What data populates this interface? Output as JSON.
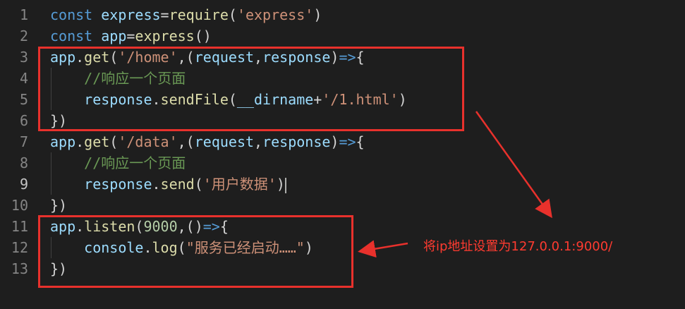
{
  "editor": {
    "active_line": 9,
    "lines": [
      {
        "n": "1",
        "tokens": [
          [
            "kw",
            "const "
          ],
          [
            "id",
            "express"
          ],
          [
            "pl",
            "="
          ],
          [
            "fn",
            "require"
          ],
          [
            "pl",
            "("
          ],
          [
            "str",
            "'express'"
          ],
          [
            "pl",
            ")"
          ]
        ]
      },
      {
        "n": "2",
        "tokens": [
          [
            "kw",
            "const "
          ],
          [
            "id",
            "app"
          ],
          [
            "pl",
            "="
          ],
          [
            "fn",
            "express"
          ],
          [
            "pl",
            "()"
          ]
        ]
      },
      {
        "n": "3",
        "tokens": [
          [
            "id",
            "app"
          ],
          [
            "pl",
            "."
          ],
          [
            "fn",
            "get"
          ],
          [
            "pl",
            "("
          ],
          [
            "str",
            "'/home'"
          ],
          [
            "pl",
            ",("
          ],
          [
            "par",
            "request"
          ],
          [
            "pl",
            ","
          ],
          [
            "par",
            "response"
          ],
          [
            "pl",
            ")"
          ],
          [
            "arrow",
            "=>"
          ],
          [
            "pl",
            "{"
          ]
        ]
      },
      {
        "n": "4",
        "tokens": [
          [
            "pl",
            "    "
          ],
          [
            "cm",
            "//响应一个页面"
          ]
        ]
      },
      {
        "n": "5",
        "tokens": [
          [
            "pl",
            "    "
          ],
          [
            "id",
            "response"
          ],
          [
            "pl",
            "."
          ],
          [
            "fn",
            "sendFile"
          ],
          [
            "pl",
            "("
          ],
          [
            "id",
            "__dirname"
          ],
          [
            "pl",
            "+"
          ],
          [
            "str",
            "'/1.html'"
          ],
          [
            "pl",
            ")"
          ]
        ]
      },
      {
        "n": "6",
        "tokens": [
          [
            "pl",
            "})"
          ]
        ]
      },
      {
        "n": "7",
        "tokens": [
          [
            "id",
            "app"
          ],
          [
            "pl",
            "."
          ],
          [
            "fn",
            "get"
          ],
          [
            "pl",
            "("
          ],
          [
            "str",
            "'/data'"
          ],
          [
            "pl",
            ",("
          ],
          [
            "par",
            "request"
          ],
          [
            "pl",
            ","
          ],
          [
            "par",
            "response"
          ],
          [
            "pl",
            ")"
          ],
          [
            "arrow",
            "=>"
          ],
          [
            "pl",
            "{"
          ]
        ]
      },
      {
        "n": "8",
        "tokens": [
          [
            "pl",
            "    "
          ],
          [
            "cm",
            "//响应一个页面"
          ]
        ]
      },
      {
        "n": "9",
        "tokens": [
          [
            "pl",
            "    "
          ],
          [
            "id",
            "response"
          ],
          [
            "pl",
            "."
          ],
          [
            "fn",
            "send"
          ],
          [
            "pl",
            "("
          ],
          [
            "str",
            "'用户数据'"
          ],
          [
            "pl",
            ")"
          ]
        ]
      },
      {
        "n": "10",
        "tokens": [
          [
            "pl",
            "})"
          ]
        ]
      },
      {
        "n": "11",
        "tokens": [
          [
            "id",
            "app"
          ],
          [
            "pl",
            "."
          ],
          [
            "fn",
            "listen"
          ],
          [
            "pl",
            "("
          ],
          [
            "num",
            "9000"
          ],
          [
            "pl",
            ",()"
          ],
          [
            "arrow",
            "=>"
          ],
          [
            "pl",
            "{"
          ]
        ]
      },
      {
        "n": "12",
        "tokens": [
          [
            "pl",
            "    "
          ],
          [
            "id",
            "console"
          ],
          [
            "pl",
            "."
          ],
          [
            "fn",
            "log"
          ],
          [
            "pl",
            "("
          ],
          [
            "str",
            "\"服务已经启动……\""
          ],
          [
            "pl",
            ")"
          ]
        ]
      },
      {
        "n": "13",
        "tokens": [
          [
            "pl",
            "})"
          ]
        ]
      }
    ]
  },
  "annotation": {
    "note": "将ip地址设置为127.0.0.1:9000/",
    "color": "#e8312c"
  }
}
